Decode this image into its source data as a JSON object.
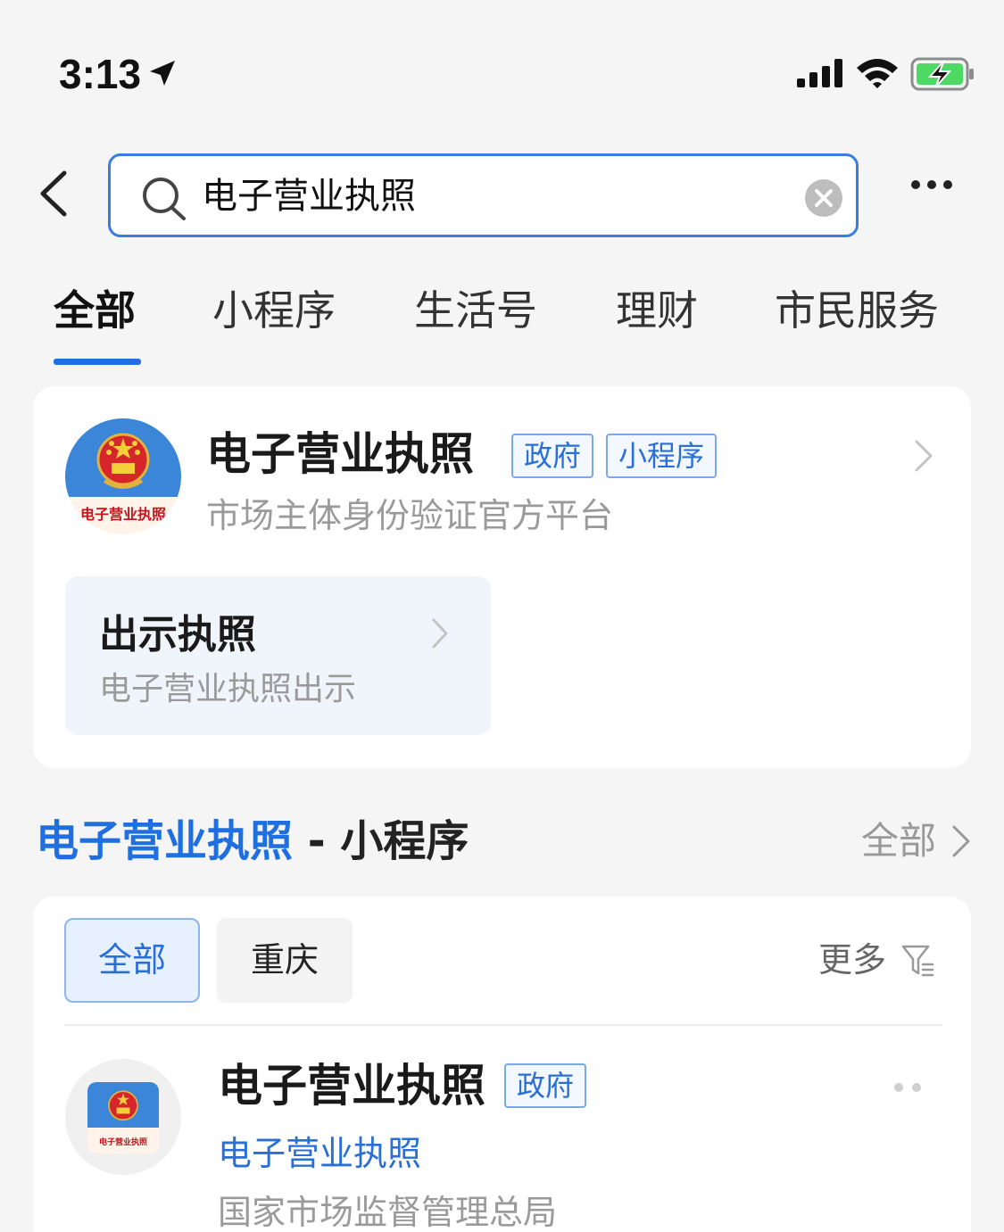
{
  "status_bar": {
    "time": "3:13",
    "icons": [
      "location-arrow-icon",
      "signal-icon",
      "wifi-icon",
      "battery-charging-icon"
    ]
  },
  "search": {
    "query": "电子营业执照"
  },
  "tabs": [
    {
      "label": "全部",
      "active": true
    },
    {
      "label": "小程序",
      "active": false
    },
    {
      "label": "生活号",
      "active": false
    },
    {
      "label": "理财",
      "active": false
    },
    {
      "label": "市民服务",
      "active": false
    }
  ],
  "top_result": {
    "logo_text": "电子营业执照",
    "title": "电子营业执照",
    "badges": [
      "政府",
      "小程序"
    ],
    "subtitle": "市场主体身份验证官方平台",
    "action": {
      "title": "出示执照",
      "subtitle": "电子营业执照出示"
    }
  },
  "section": {
    "keyword": "电子营业执照",
    "suffix": " - 小程序",
    "all_label": "全部"
  },
  "filters": {
    "chips": [
      "全部",
      "重庆"
    ],
    "more_label": "更多"
  },
  "list_item": {
    "logo_text": "电子营业执照",
    "title": "电子营业执照",
    "badge": "政府",
    "link": "电子营业执照",
    "org": "国家市场监督管理总局"
  },
  "colors": {
    "accent": "#1f6fe0",
    "badge_border": "#7aa8e8",
    "background": "#f5f5f5"
  }
}
